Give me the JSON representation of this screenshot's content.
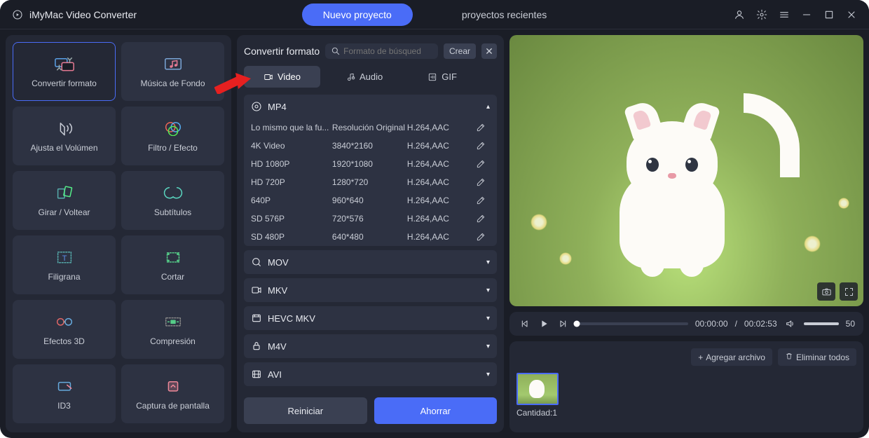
{
  "titlebar": {
    "app_name": "iMyMac Video Converter",
    "new_project": "Nuevo proyecto",
    "recent_projects": "proyectos recientes"
  },
  "sidebar": {
    "items": [
      {
        "label": "Convertir formato"
      },
      {
        "label": "Música de Fondo"
      },
      {
        "label": "Ajusta el Volúmen"
      },
      {
        "label": "Filtro / Efecto"
      },
      {
        "label": "Girar / Voltear"
      },
      {
        "label": "Subtítulos"
      },
      {
        "label": "Filigrana"
      },
      {
        "label": "Cortar"
      },
      {
        "label": "Efectos 3D"
      },
      {
        "label": "Compresión"
      },
      {
        "label": "ID3"
      },
      {
        "label": "Captura de pantalla"
      }
    ]
  },
  "middle": {
    "title": "Convertir formato",
    "search_placeholder": "Formato de búsqued",
    "create_label": "Crear",
    "tabs": [
      {
        "label": "Video"
      },
      {
        "label": "Audio"
      },
      {
        "label": "GIF"
      }
    ],
    "groups": [
      {
        "name": "MP4",
        "expanded": true,
        "rows": [
          {
            "preset": "Lo mismo que la fu...",
            "res": "Resolución Original",
            "codec": "H.264,AAC"
          },
          {
            "preset": "4K Video",
            "res": "3840*2160",
            "codec": "H.264,AAC"
          },
          {
            "preset": "HD 1080P",
            "res": "1920*1080",
            "codec": "H.264,AAC"
          },
          {
            "preset": "HD 720P",
            "res": "1280*720",
            "codec": "H.264,AAC"
          },
          {
            "preset": "640P",
            "res": "960*640",
            "codec": "H.264,AAC"
          },
          {
            "preset": "SD 576P",
            "res": "720*576",
            "codec": "H.264,AAC"
          },
          {
            "preset": "SD 480P",
            "res": "640*480",
            "codec": "H.264,AAC"
          }
        ]
      },
      {
        "name": "MOV",
        "expanded": false
      },
      {
        "name": "MKV",
        "expanded": false
      },
      {
        "name": "HEVC MKV",
        "expanded": false
      },
      {
        "name": "M4V",
        "expanded": false
      },
      {
        "name": "AVI",
        "expanded": false
      }
    ],
    "reset_label": "Reiniciar",
    "save_label": "Ahorrar"
  },
  "player": {
    "current_time": "00:00:00",
    "total_time": "00:02:53",
    "volume": "50"
  },
  "queue": {
    "add_label": "Agregar archivo",
    "clear_label": "Eliminar todos",
    "count_label": "Cantidad:1"
  }
}
